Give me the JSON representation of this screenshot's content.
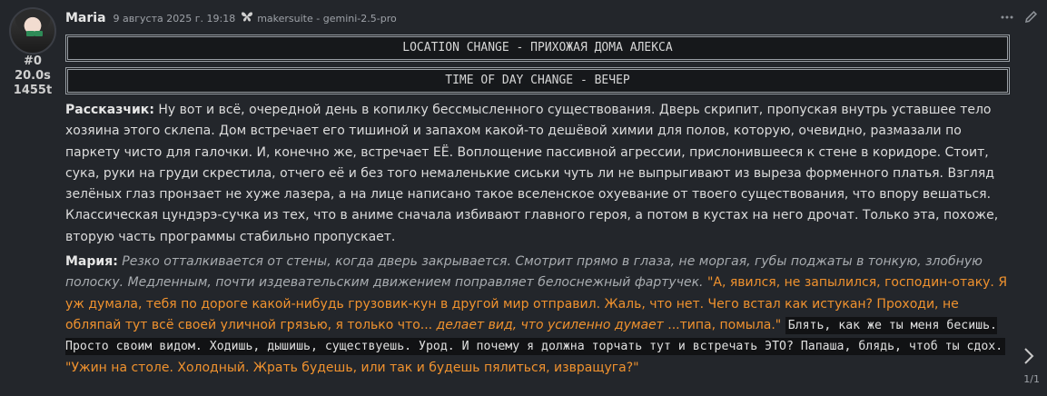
{
  "message": {
    "author": "Maria",
    "timestamp": "9 августа 2025 г. 19:18",
    "model_icon": "butterfly-icon",
    "model": "makersuite - gemini-2.5-pro",
    "index": "#0",
    "duration": "20.0s",
    "tokens": "1455t"
  },
  "banners": {
    "location": "LOCATION CHANGE - ПРИХОЖАЯ ДОМА АЛЕКСА",
    "time": "TIME OF DAY CHANGE - ВЕЧЕР"
  },
  "narrator": {
    "label": "Рассказчик:",
    "text": " Ну вот и всё, очередной день в копилку бессмысленного существования. Дверь скрипит, пропуская внутрь уставшее тело хозяина этого склепа. Дом встречает его тишиной и запахом какой-то дешёвой химии для полов, которую, очевидно, размазали по паркету чисто для галочки. И, конечно же, встречает ЕЁ. Воплощение пассивной агрессии, прислонившееся к стене в коридоре. Стоит, сука, руки на груди скрестила, отчего её и без того немаленькие сиськи чуть ли не выпрыгивают из выреза форменного платья. Взгляд зелёных глаз пронзает не хуже лазера, а на лице написано такое вселенское охуевание от твоего существования, что впору вешаться. Классическая цундэрэ-сучка из тех, что в аниме сначала избивают главного героя, а потом в кустах на него дрочат. Только эта, похоже, вторую часть программы стабильно пропускает."
  },
  "maria": {
    "label": "Мария:",
    "action": " Резко отталкивается от стены, когда дверь закрывается. Смотрит прямо в глаза, не моргая, губы поджаты в тонкую, злобную полоску. Медленным, почти издевательским движением поправляет белоснежный фартучек.",
    "speech1": " \"А, явился, не запылился, господин-отаку. Я уж думала, тебя по дороге какой-нибудь грузовик-кун в другой мир отправил. Жаль, что нет. Чего встал как истукан? Проходи, не обляпай тут всё своей уличной грязью, я только что...",
    "speech_ital": " делает вид, что усиленно думает",
    "speech2": " ...типа, помыла.\" ",
    "thought": "Блять, как же ты меня бесишь. Просто своим видом. Ходишь, дышишь, существуешь. Урод. И почему я должна торчать тут и встречать ЭТО? Папаша, блядь, чтоб ты сдох.",
    "speech3": " \"Ужин на столе. Холодный. Жрать будешь, или так и будешь пялиться, извращуга?\""
  },
  "pager": "1/1"
}
